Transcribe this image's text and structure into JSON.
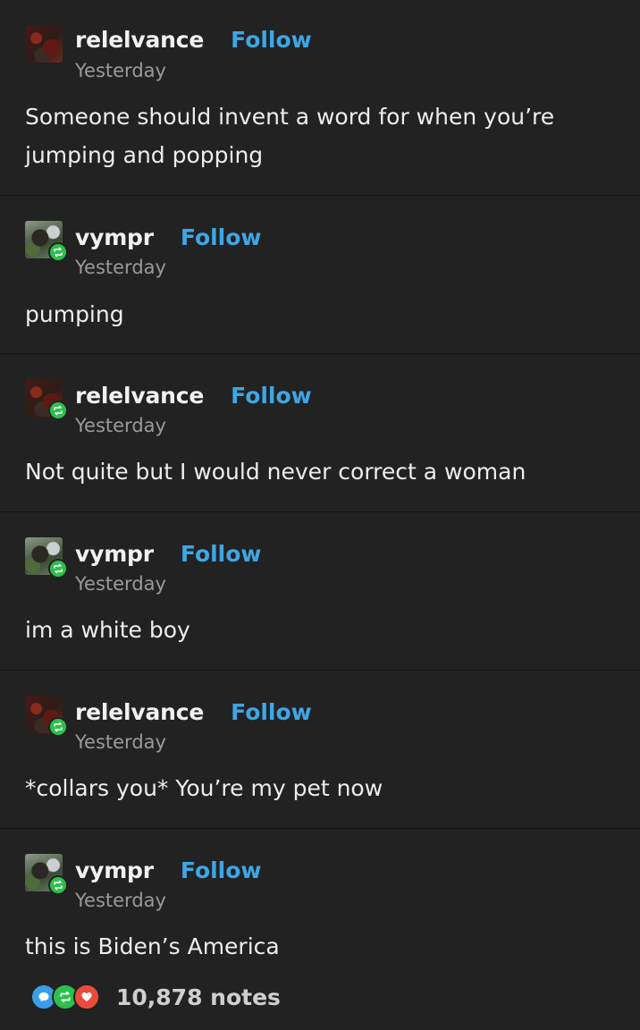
{
  "posts": [
    {
      "username": "relelvance",
      "follow": "Follow",
      "time": "Yesterday",
      "text": "Someone should invent a word for when you’re jumping and popping"
    },
    {
      "username": "vympr",
      "follow": "Follow",
      "time": "Yesterday",
      "text": "pumping"
    },
    {
      "username": "relelvance",
      "follow": "Follow",
      "time": "Yesterday",
      "text": "Not quite but I would never correct a woman"
    },
    {
      "username": "vympr",
      "follow": "Follow",
      "time": "Yesterday",
      "text": "im a white boy"
    },
    {
      "username": "relelvance",
      "follow": "Follow",
      "time": "Yesterday",
      "text": "*collars you* You’re my pet now"
    },
    {
      "username": "vympr",
      "follow": "Follow",
      "time": "Yesterday",
      "text": "this is Biden’s America"
    }
  ],
  "footer": {
    "notes": "10,878 notes",
    "icons": [
      "reply-bubble-icon",
      "reblog-icon",
      "heart-icon"
    ]
  },
  "colors": {
    "background": "#222222",
    "follow": "#3ea6e5",
    "reblog": "#2bc14b",
    "reply": "#3a9ee6",
    "heart": "#ea4b3c"
  }
}
